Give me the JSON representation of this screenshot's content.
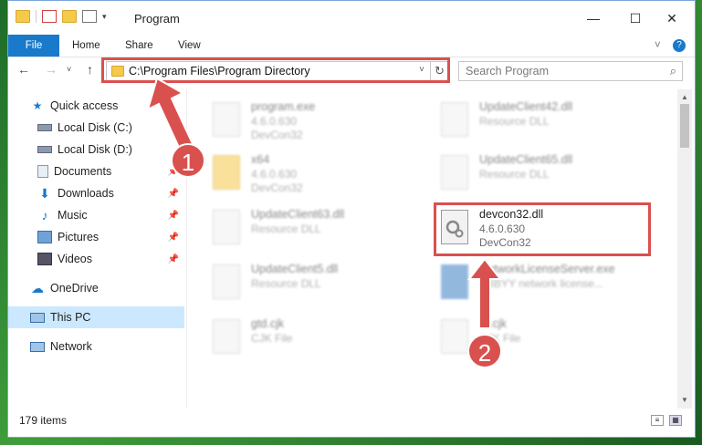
{
  "window": {
    "title": "Program",
    "controls": {
      "minimize": "—",
      "maximize": "☐",
      "close": "✕"
    }
  },
  "ribbon": {
    "tabs": [
      {
        "label": "File"
      },
      {
        "label": "Home"
      },
      {
        "label": "Share"
      },
      {
        "label": "View"
      }
    ],
    "expand_icon": "˅",
    "help_icon": "?"
  },
  "nav": {
    "back": "←",
    "forward": "→",
    "dropdown": "˅",
    "up": "↑",
    "address": "C:\\Program Files\\Program Directory",
    "refresh": "↻",
    "search_placeholder": "Search Program"
  },
  "sidebar": {
    "items": [
      {
        "label": "Quick access",
        "icon": "star-icon"
      },
      {
        "label": "Local Disk (C:)",
        "icon": "drive-icon"
      },
      {
        "label": "Local Disk (D:)",
        "icon": "drive-icon"
      },
      {
        "label": "Documents",
        "icon": "documents-icon"
      },
      {
        "label": "Downloads",
        "icon": "downloads-icon"
      },
      {
        "label": "Music",
        "icon": "music-icon"
      },
      {
        "label": "Pictures",
        "icon": "pictures-icon"
      },
      {
        "label": "Videos",
        "icon": "videos-icon"
      },
      {
        "label": "OneDrive",
        "icon": "cloud-icon"
      },
      {
        "label": "This PC",
        "icon": "computer-icon"
      },
      {
        "label": "Network",
        "icon": "network-icon"
      }
    ]
  },
  "files": [
    {
      "name": "program.exe",
      "line2": "4.6.0.630",
      "line3": "DevCon32"
    },
    {
      "name": "UpdateClient42.dll",
      "line2": "Resource DLL",
      "line3": ""
    },
    {
      "name": "x64",
      "line2": "4.6.0.630",
      "line3": "DevCon32"
    },
    {
      "name": "UpdateClient65.dll",
      "line2": "Resource DLL",
      "line3": ""
    },
    {
      "name": "UpdateClient63.dll",
      "line2": "Resource DLL",
      "line3": ""
    },
    {
      "name": "devcon32.dll",
      "line2": "4.6.0.630",
      "line3": "DevCon32"
    },
    {
      "name": "UpdateClient5.dll",
      "line2": "Resource DLL",
      "line3": ""
    },
    {
      "name": "NetworkLicenseServer.exe",
      "line2": "ABBYY network license...",
      "line3": ""
    },
    {
      "name": "gtd.cjk",
      "line2": "CJK File",
      "line3": ""
    },
    {
      "name": "rd.cjk",
      "line2": "CJK File",
      "line3": ""
    }
  ],
  "status": {
    "items": "179 items"
  },
  "annotations": {
    "badge1": "1",
    "badge2": "2",
    "color": "#d9514e"
  }
}
